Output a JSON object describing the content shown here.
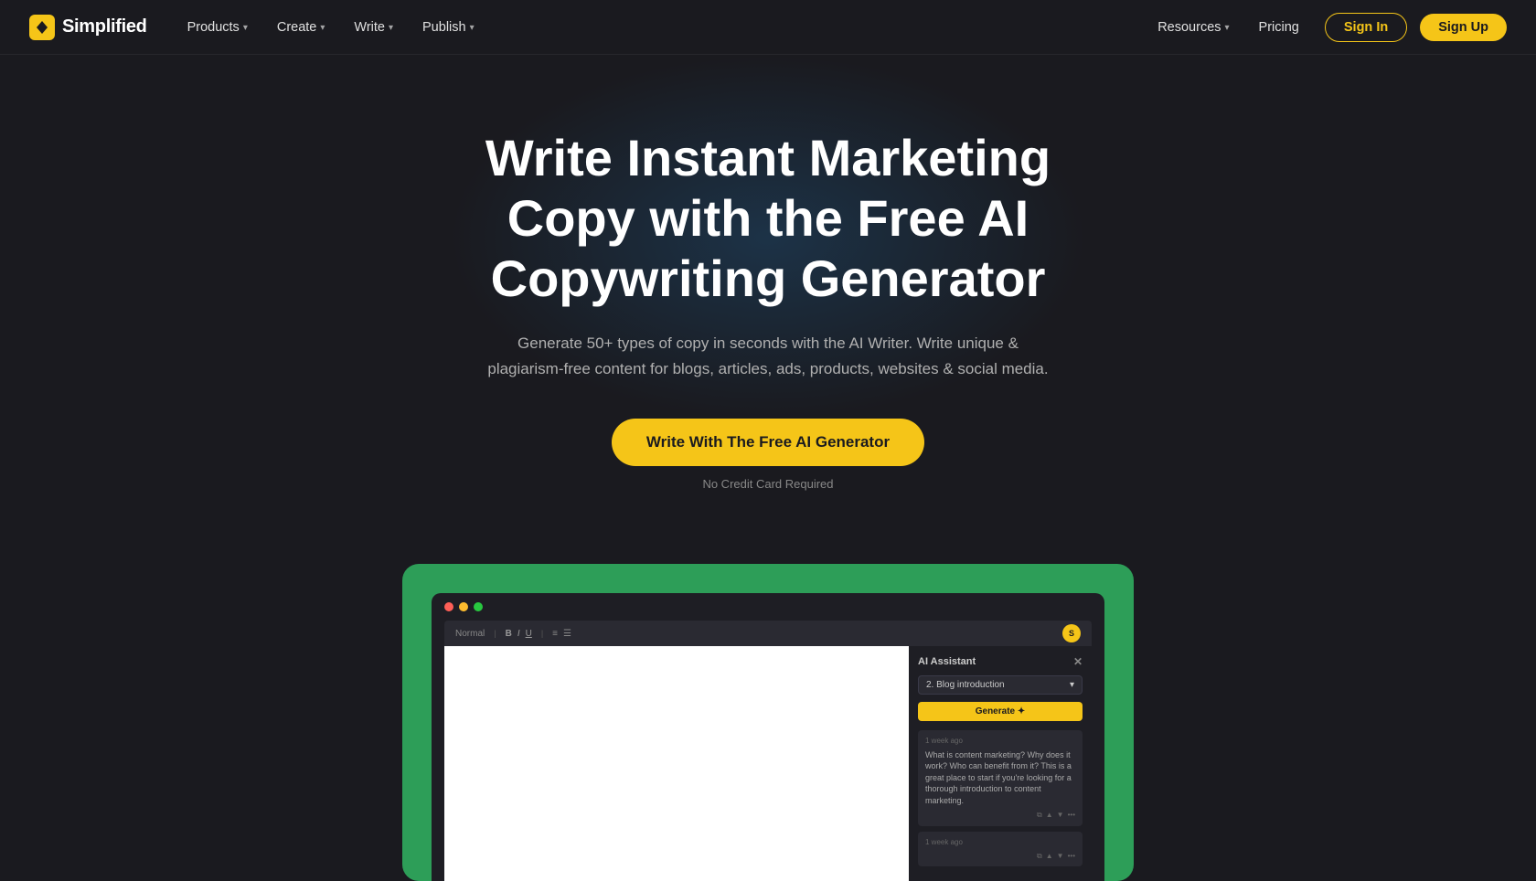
{
  "brand": {
    "logo_text": "Simplified",
    "logo_icon_unicode": "⚡"
  },
  "nav": {
    "items": [
      {
        "label": "Products",
        "has_dropdown": true
      },
      {
        "label": "Create",
        "has_dropdown": true
      },
      {
        "label": "Write",
        "has_dropdown": true
      },
      {
        "label": "Publish",
        "has_dropdown": true
      }
    ],
    "right_items": [
      {
        "label": "Resources",
        "has_dropdown": true
      },
      {
        "label": "Pricing",
        "has_dropdown": false
      }
    ],
    "signin_label": "Sign In",
    "signup_label": "Sign Up"
  },
  "hero": {
    "title": "Write Instant Marketing Copy with the Free AI Copywriting Generator",
    "subtitle": "Generate 50+ types of copy in seconds with the AI Writer. Write unique & plagiarism-free content for blogs, articles, ads, products, websites & social media.",
    "cta_label": "Write With The Free AI Generator",
    "no_cc_label": "No Credit Card Required"
  },
  "preview": {
    "browser_dots": [
      "red",
      "yellow",
      "green"
    ],
    "ai_panel": {
      "title": "AI Assistant",
      "dropdown_label": "2. Blog introduction",
      "generate_btn": "Generate ✦",
      "chat_items": [
        {
          "time": "1 week ago",
          "text": "What is content marketing? Why does it work? Who can benefit from it? This is a great place to start if you're looking for a thorough introduction to content marketing.",
          "actions": [
            "copy",
            "like",
            "dislike",
            "more"
          ]
        },
        {
          "time": "1 week ago",
          "text": "",
          "actions": [
            "copy",
            "like",
            "dislike",
            "more"
          ]
        }
      ]
    }
  },
  "colors": {
    "accent": "#f5c518",
    "background": "#1a1a1f",
    "preview_bg": "#2d9e58",
    "nav_border": "rgba(255,255,255,0.06)"
  }
}
